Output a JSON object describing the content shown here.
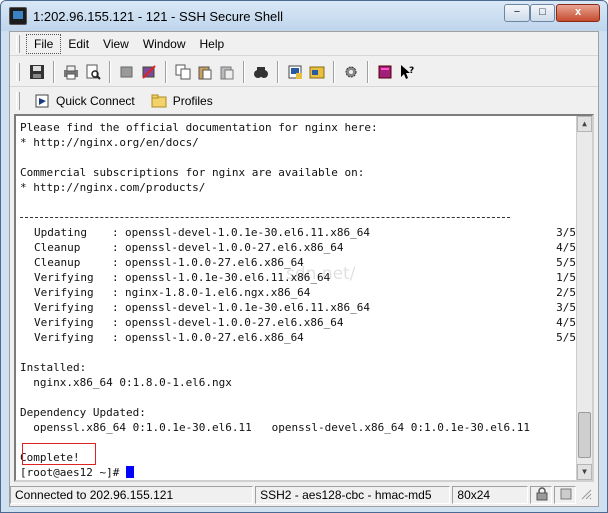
{
  "window": {
    "title": "1:202.96.155.121 - 121 - SSH Secure Shell",
    "min_label": "−",
    "max_label": "□",
    "close_label": "x"
  },
  "menubar": {
    "items": [
      "File",
      "Edit",
      "View",
      "Window",
      "Help"
    ]
  },
  "toolbar": {
    "icons": [
      "save-icon",
      "print-icon",
      "print-preview-icon",
      "disconnect-icon",
      "connect-icon",
      "copy-icon",
      "paste-icon",
      "paste-special-icon",
      "find-icon",
      "new-terminal-icon",
      "file-transfer-icon",
      "settings-icon",
      "help-book-icon",
      "context-help-icon"
    ]
  },
  "quickbar": {
    "quick_connect": "Quick Connect",
    "profiles": "Profiles"
  },
  "terminal": {
    "intro": [
      "Please find the official documentation for nginx here:",
      "* http://nginx.org/en/docs/",
      "",
      "Commercial subscriptions for nginx are available on:",
      "* http://nginx.com/products/",
      ""
    ],
    "transactions": [
      {
        "action": "Updating",
        "package": "openssl-devel-1.0.1e-30.el6.11.x86_64",
        "count": "3/5"
      },
      {
        "action": "Cleanup",
        "package": "openssl-devel-1.0.0-27.el6.x86_64",
        "count": "4/5"
      },
      {
        "action": "Cleanup",
        "package": "openssl-1.0.0-27.el6.x86_64",
        "count": "5/5"
      },
      {
        "action": "Verifying",
        "package": "openssl-1.0.1e-30.el6.11.x86_64",
        "count": "1/5"
      },
      {
        "action": "Verifying",
        "package": "nginx-1.8.0-1.el6.ngx.x86_64",
        "count": "2/5"
      },
      {
        "action": "Verifying",
        "package": "openssl-devel-1.0.1e-30.el6.11.x86_64",
        "count": "3/5"
      },
      {
        "action": "Verifying",
        "package": "openssl-devel-1.0.0-27.el6.x86_64",
        "count": "4/5"
      },
      {
        "action": "Verifying",
        "package": "openssl-1.0.0-27.el6.x86_64",
        "count": "5/5"
      }
    ],
    "installed_header": "Installed:",
    "installed_line": "  nginx.x86_64 0:1.8.0-1.el6.ngx",
    "dep_header": "Dependency Updated:",
    "dep_line": "  openssl.x86_64 0:1.0.1e-30.el6.11   openssl-devel.x86_64 0:1.0.1e-30.el6.11",
    "complete": "Complete!",
    "prompt": "[root@aes12 ~]# ",
    "watermark": "sdn.net/"
  },
  "statusbar": {
    "connection": "Connected to 202.96.155.121",
    "encryption": "SSH2 - aes128-cbc - hmac-md5",
    "size": "80x24"
  }
}
